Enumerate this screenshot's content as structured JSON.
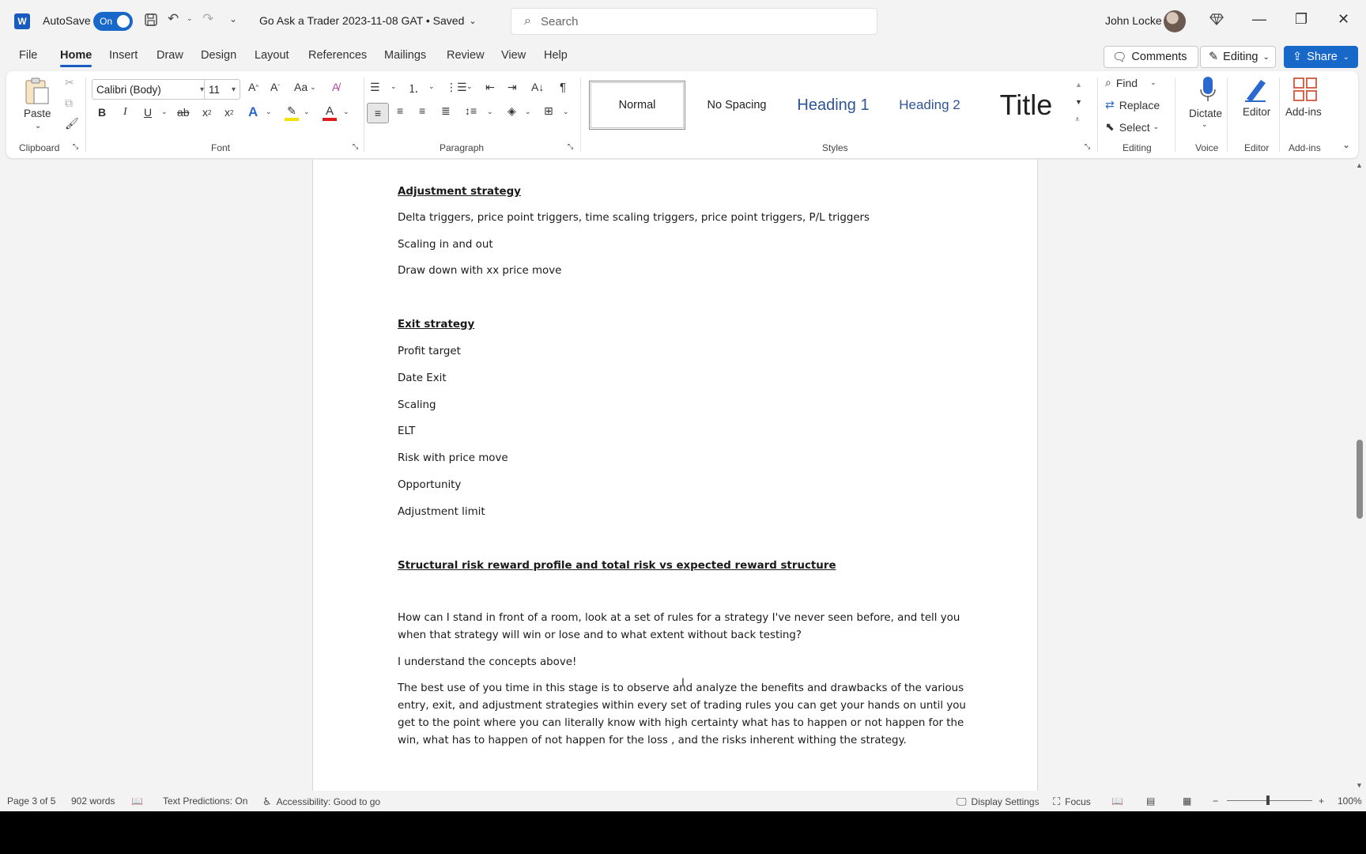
{
  "titlebar": {
    "app_letter": "W",
    "autosave_label": "AutoSave",
    "autosave_state": "On",
    "doc_title": "Go Ask a Trader 2023-11-08 GAT • Saved",
    "search_placeholder": "Search",
    "user_name": "John Locke"
  },
  "menu": {
    "tabs": [
      "File",
      "Home",
      "Insert",
      "Draw",
      "Design",
      "Layout",
      "References",
      "Mailings",
      "Review",
      "View",
      "Help"
    ],
    "active_tab": "Home",
    "comments_label": "Comments",
    "editing_label": "Editing",
    "share_label": "Share"
  },
  "ribbon": {
    "clipboard": {
      "paste_label": "Paste",
      "group_label": "Clipboard"
    },
    "font": {
      "font_name": "Calibri (Body)",
      "font_size": "11",
      "group_label": "Font",
      "case_label": "Aa"
    },
    "paragraph": {
      "group_label": "Paragraph"
    },
    "styles": {
      "items": [
        "Normal",
        "No Spacing",
        "Heading 1",
        "Heading 2",
        "Title"
      ],
      "group_label": "Styles"
    },
    "editing": {
      "find": "Find",
      "replace": "Replace",
      "select": "Select",
      "group_label": "Editing"
    },
    "voice": {
      "dictate": "Dictate",
      "group_label": "Voice"
    },
    "editor": {
      "label": "Editor",
      "group_label": "Editor"
    },
    "addins": {
      "label": "Add-ins",
      "group_label": "Add-ins"
    }
  },
  "document": {
    "paragraphs": [
      {
        "text": "Adjustment strategy",
        "style": "heading"
      },
      {
        "text": "Delta triggers, price point triggers, time scaling triggers, price point triggers, P/L triggers",
        "style": "body"
      },
      {
        "text": "Scaling in and out",
        "style": "body"
      },
      {
        "text": "Draw down with xx price move",
        "style": "body"
      },
      {
        "text": "Exit strategy",
        "style": "heading"
      },
      {
        "text": "Profit target",
        "style": "body"
      },
      {
        "text": "Date Exit",
        "style": "body"
      },
      {
        "text": "Scaling",
        "style": "body"
      },
      {
        "text": "ELT",
        "style": "body"
      },
      {
        "text": "Risk with price move",
        "style": "body"
      },
      {
        "text": "Opportunity",
        "style": "body"
      },
      {
        "text": "Adjustment limit",
        "style": "body"
      },
      {
        "text": "Structural risk reward profile and total risk vs expected reward structure",
        "style": "heading"
      },
      {
        "text": "How can I stand in front of a room, look at a set of rules for a strategy I've never seen before, and tell you when that strategy will win or lose and to what extent without back testing?",
        "style": "body"
      },
      {
        "text": "I understand the concepts above!",
        "style": "body"
      },
      {
        "text": "The best use of you time in this stage is to observe and analyze the benefits and drawbacks of the various entry, exit, and adjustment strategies within every set of trading rules you can get your hands on until you get to the point where you can literally know with high certainty what has to happen or not happen for the win, what has to happen of not happen for the loss , and the risks inherent withing the strategy.",
        "style": "body"
      }
    ]
  },
  "statusbar": {
    "page": "Page 3 of 5",
    "words": "902 words",
    "text_predictions": "Text Predictions: On",
    "accessibility": "Accessibility: Good to go",
    "display_settings": "Display Settings",
    "focus": "Focus",
    "zoom_level": "100%"
  },
  "colors": {
    "accent": "#185abd",
    "toggle": "#1868c9",
    "font_color_bar": "#e01b1b",
    "highlight_bar": "#f5e200"
  }
}
